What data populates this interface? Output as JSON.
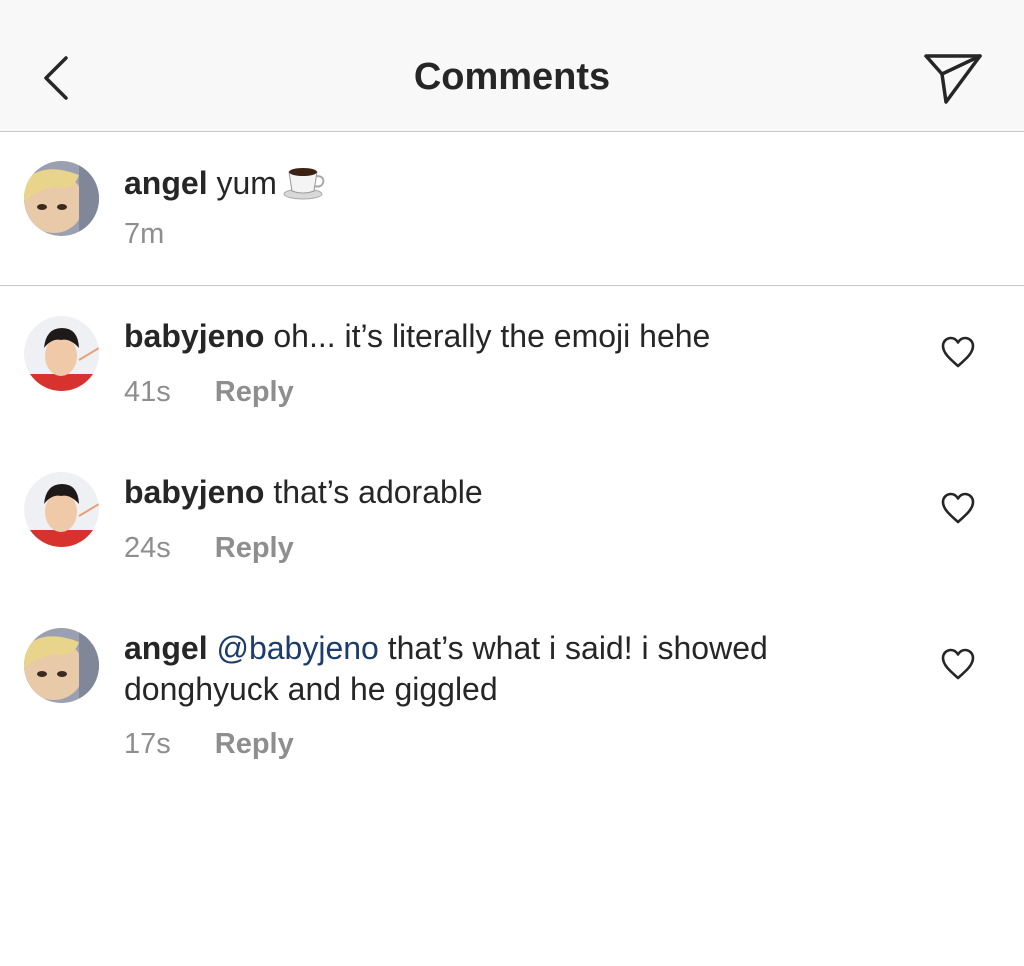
{
  "header": {
    "title": "Comments",
    "back_icon": "chevron-left-icon",
    "send_icon": "paper-plane-icon"
  },
  "caption": {
    "username": "angel",
    "text": "yum",
    "emoji_icon": "coffee-cup-emoji",
    "time": "7m"
  },
  "comments": [
    {
      "username": "babyjeno",
      "text": "oh... it’s literally the emoji hehe",
      "time": "41s",
      "reply_label": "Reply"
    },
    {
      "username": "babyjeno",
      "text": "that’s adorable",
      "time": "24s",
      "reply_label": "Reply"
    },
    {
      "username": "angel",
      "mention": "@babyjeno",
      "text_line1": "that’s what i said! i showed",
      "text_line2": "donghyuck and he giggled",
      "time": "17s",
      "reply_label": "Reply"
    }
  ],
  "colors": {
    "text": "#262626",
    "secondary": "#8e8e8e",
    "mention": "#1c3c6e",
    "divider": "#c7c7c7",
    "header_bg": "#f8f8f8"
  }
}
